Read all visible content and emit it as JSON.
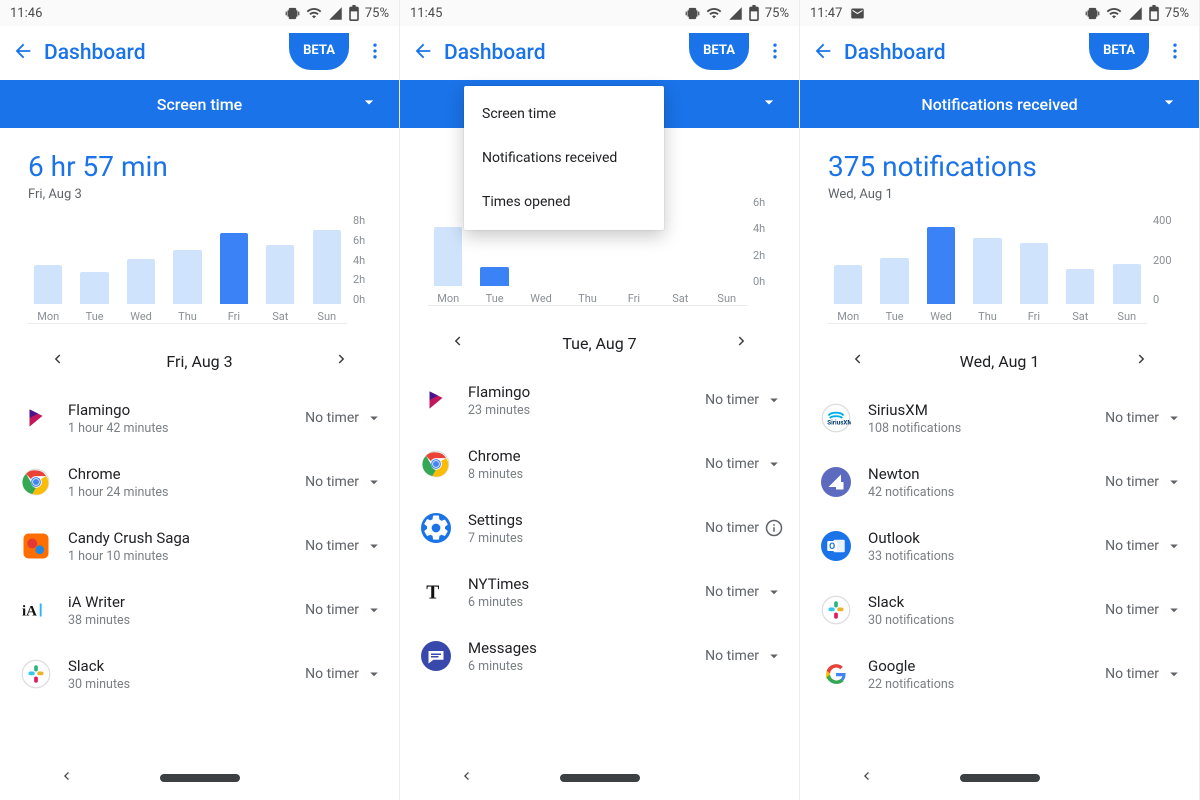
{
  "status": {
    "battery_pct": "75%"
  },
  "badge": "BETA",
  "header_title": "Dashboard",
  "no_timer": "No timer",
  "dropdown": {
    "items": [
      "Screen time",
      "Notifications received",
      "Times opened"
    ]
  },
  "panels": [
    {
      "time": "11:46",
      "has_mail_icon": false,
      "selector": "Screen time",
      "headline": "6 hr 57 min",
      "headline_sub": "Fri, Aug 3",
      "date_nav": "Fri, Aug 3",
      "show_dropdown": false,
      "y_ticks": [
        "8h",
        "6h",
        "4h",
        "2h",
        "0h"
      ],
      "apps": [
        {
          "name": "Flamingo",
          "sub": "1 hour 42 minutes",
          "icon": "flamingo",
          "timer": "notimer"
        },
        {
          "name": "Chrome",
          "sub": "1 hour 24 minutes",
          "icon": "chrome",
          "timer": "notimer"
        },
        {
          "name": "Candy Crush Saga",
          "sub": "1 hour 10 minutes",
          "icon": "candycrush",
          "timer": "notimer"
        },
        {
          "name": "iA Writer",
          "sub": "38 minutes",
          "icon": "iawriter",
          "timer": "notimer"
        },
        {
          "name": "Slack",
          "sub": "30 minutes",
          "icon": "slack",
          "timer": "notimer"
        }
      ]
    },
    {
      "time": "11:45",
      "has_mail_icon": false,
      "selector": "",
      "headline": "",
      "headline_sub": "",
      "date_nav": "Tue, Aug 7",
      "show_dropdown": true,
      "y_ticks": [
        "6h",
        "4h",
        "2h",
        "0h"
      ],
      "apps": [
        {
          "name": "Flamingo",
          "sub": "23 minutes",
          "icon": "flamingo",
          "timer": "notimer"
        },
        {
          "name": "Chrome",
          "sub": "8 minutes",
          "icon": "chrome",
          "timer": "notimer"
        },
        {
          "name": "Settings",
          "sub": "7 minutes",
          "icon": "settings",
          "timer": "info"
        },
        {
          "name": "NYTimes",
          "sub": "6 minutes",
          "icon": "nytimes",
          "timer": "notimer"
        },
        {
          "name": "Messages",
          "sub": "6 minutes",
          "icon": "messages",
          "timer": "notimer"
        }
      ]
    },
    {
      "time": "11:47",
      "has_mail_icon": true,
      "selector": "Notifications received",
      "headline": "375 notifications",
      "headline_sub": "Wed, Aug 1",
      "date_nav": "Wed, Aug 1",
      "show_dropdown": false,
      "y_ticks": [
        "400",
        "200",
        "0"
      ],
      "apps": [
        {
          "name": "SiriusXM",
          "sub": "108 notifications",
          "icon": "siriusxm",
          "timer": "notimer"
        },
        {
          "name": "Newton",
          "sub": "42 notifications",
          "icon": "newton",
          "timer": "notimer"
        },
        {
          "name": "Outlook",
          "sub": "33 notifications",
          "icon": "outlook",
          "timer": "notimer"
        },
        {
          "name": "Slack",
          "sub": "30 notifications",
          "icon": "slack",
          "timer": "notimer"
        },
        {
          "name": "Google",
          "sub": "22 notifications",
          "icon": "google",
          "timer": "notimer"
        }
      ]
    }
  ],
  "chart_data": [
    {
      "type": "bar",
      "title": "Screen time",
      "ylabel": "hours",
      "ylim": [
        0,
        8
      ],
      "categories": [
        "Mon",
        "Tue",
        "Wed",
        "Thu",
        "Fri",
        "Sat",
        "Sun"
      ],
      "values": [
        3.8,
        3.1,
        4.4,
        5.3,
        6.9,
        5.8,
        7.2
      ],
      "selected_index": 4
    },
    {
      "type": "bar",
      "title": "Screen time",
      "ylabel": "hours",
      "ylim": [
        0,
        6
      ],
      "categories": [
        "Mon",
        "Tue",
        "Wed",
        "Thu",
        "Fri",
        "Sat",
        "Sun"
      ],
      "values": [
        4.3,
        1.4,
        0,
        0,
        0,
        0,
        0
      ],
      "selected_index": 1
    },
    {
      "type": "bar",
      "title": "Notifications received",
      "ylabel": "notifications",
      "ylim": [
        0,
        400
      ],
      "categories": [
        "Mon",
        "Tue",
        "Wed",
        "Thu",
        "Fri",
        "Sat",
        "Sun"
      ],
      "values": [
        190,
        225,
        375,
        320,
        300,
        170,
        195
      ],
      "selected_index": 2
    }
  ]
}
